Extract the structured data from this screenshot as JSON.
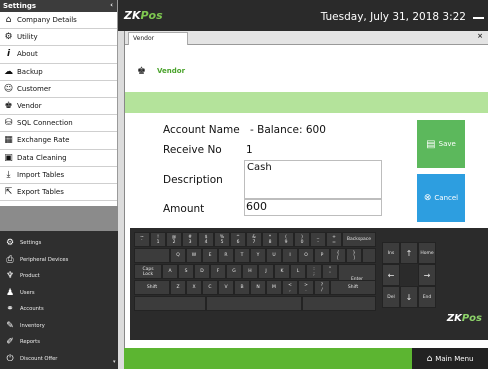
{
  "sidebar": {
    "header": "Settings",
    "items": [
      {
        "label": "Company Details",
        "icon": "home-icon"
      },
      {
        "label": "Utility",
        "icon": "gear-icon"
      },
      {
        "label": "About",
        "icon": "info-icon"
      },
      {
        "label": "Backup",
        "icon": "cloud-icon"
      },
      {
        "label": "Customer",
        "icon": "customer-icon"
      },
      {
        "label": "Vendor",
        "icon": "vendor-icon"
      },
      {
        "label": "SQL Connection",
        "icon": "database-icon"
      },
      {
        "label": "Exchange Rate",
        "icon": "money-icon"
      },
      {
        "label": "Data Cleaning",
        "icon": "cleaning-icon"
      },
      {
        "label": "Import Tables",
        "icon": "import-icon"
      },
      {
        "label": "Export Tables",
        "icon": "export-icon"
      }
    ],
    "menu": [
      {
        "label": "Settings",
        "icon": "gears-icon"
      },
      {
        "label": "Peripheral Devices",
        "icon": "printer-icon"
      },
      {
        "label": "Product",
        "icon": "product-icon"
      },
      {
        "label": "Users",
        "icon": "users-icon"
      },
      {
        "label": "Accounts",
        "icon": "accounts-icon"
      },
      {
        "label": "Inventory",
        "icon": "inventory-icon"
      },
      {
        "label": "Reports",
        "icon": "reports-icon"
      },
      {
        "label": "Discount Offer",
        "icon": "power-icon"
      }
    ]
  },
  "topbar": {
    "logo_zk": "ZK",
    "logo_pos": "Pos",
    "datetime": "Tuesday, July 31, 2018 3:22"
  },
  "tab": {
    "label": "Vendor"
  },
  "form": {
    "title": "Vendor",
    "account_label": "Account Name",
    "account_value": "- Balance: 600",
    "receive_label": "Receive No",
    "receive_value": "1",
    "description_label": "Description",
    "description_value": "Cash",
    "amount_label": "Amount",
    "amount_value": "600",
    "save_label": "Save",
    "cancel_label": "Cancel"
  },
  "keyboard": {
    "row1": [
      "~\n`",
      "!\n1",
      "@\n2",
      "#\n3",
      "$\n4",
      "%\n5",
      "^\n6",
      "&\n7",
      "*\n8",
      "(\n9",
      ")\n0",
      "_\n-",
      "+\n=",
      "Backspace"
    ],
    "row2": [
      "Q",
      "W",
      "E",
      "R",
      "T",
      "Y",
      "U",
      "I",
      "O",
      "P",
      "{\n[",
      "}\n]"
    ],
    "row3": [
      "Caps\nLock",
      "A",
      "S",
      "D",
      "F",
      "G",
      "H",
      "J",
      "K",
      "L",
      ":\n;",
      "\"\n'",
      "Enter"
    ],
    "row4": [
      "Shift",
      "Z",
      "X",
      "C",
      "V",
      "B",
      "N",
      "M",
      "<\n,",
      ">\n.",
      "?\n/",
      "Shift"
    ],
    "nav": {
      "ins": "Ins",
      "home": "Home",
      "del": "Del",
      "end": "End"
    },
    "logo_zk": "ZK",
    "logo_pos": "Pos"
  },
  "bottom": {
    "main_menu": "Main Menu"
  },
  "colors": {
    "accent_green": "#5cb531",
    "save_green": "#5cb85c",
    "cancel_blue": "#2d9ee0",
    "light_green": "#b4e39b"
  }
}
